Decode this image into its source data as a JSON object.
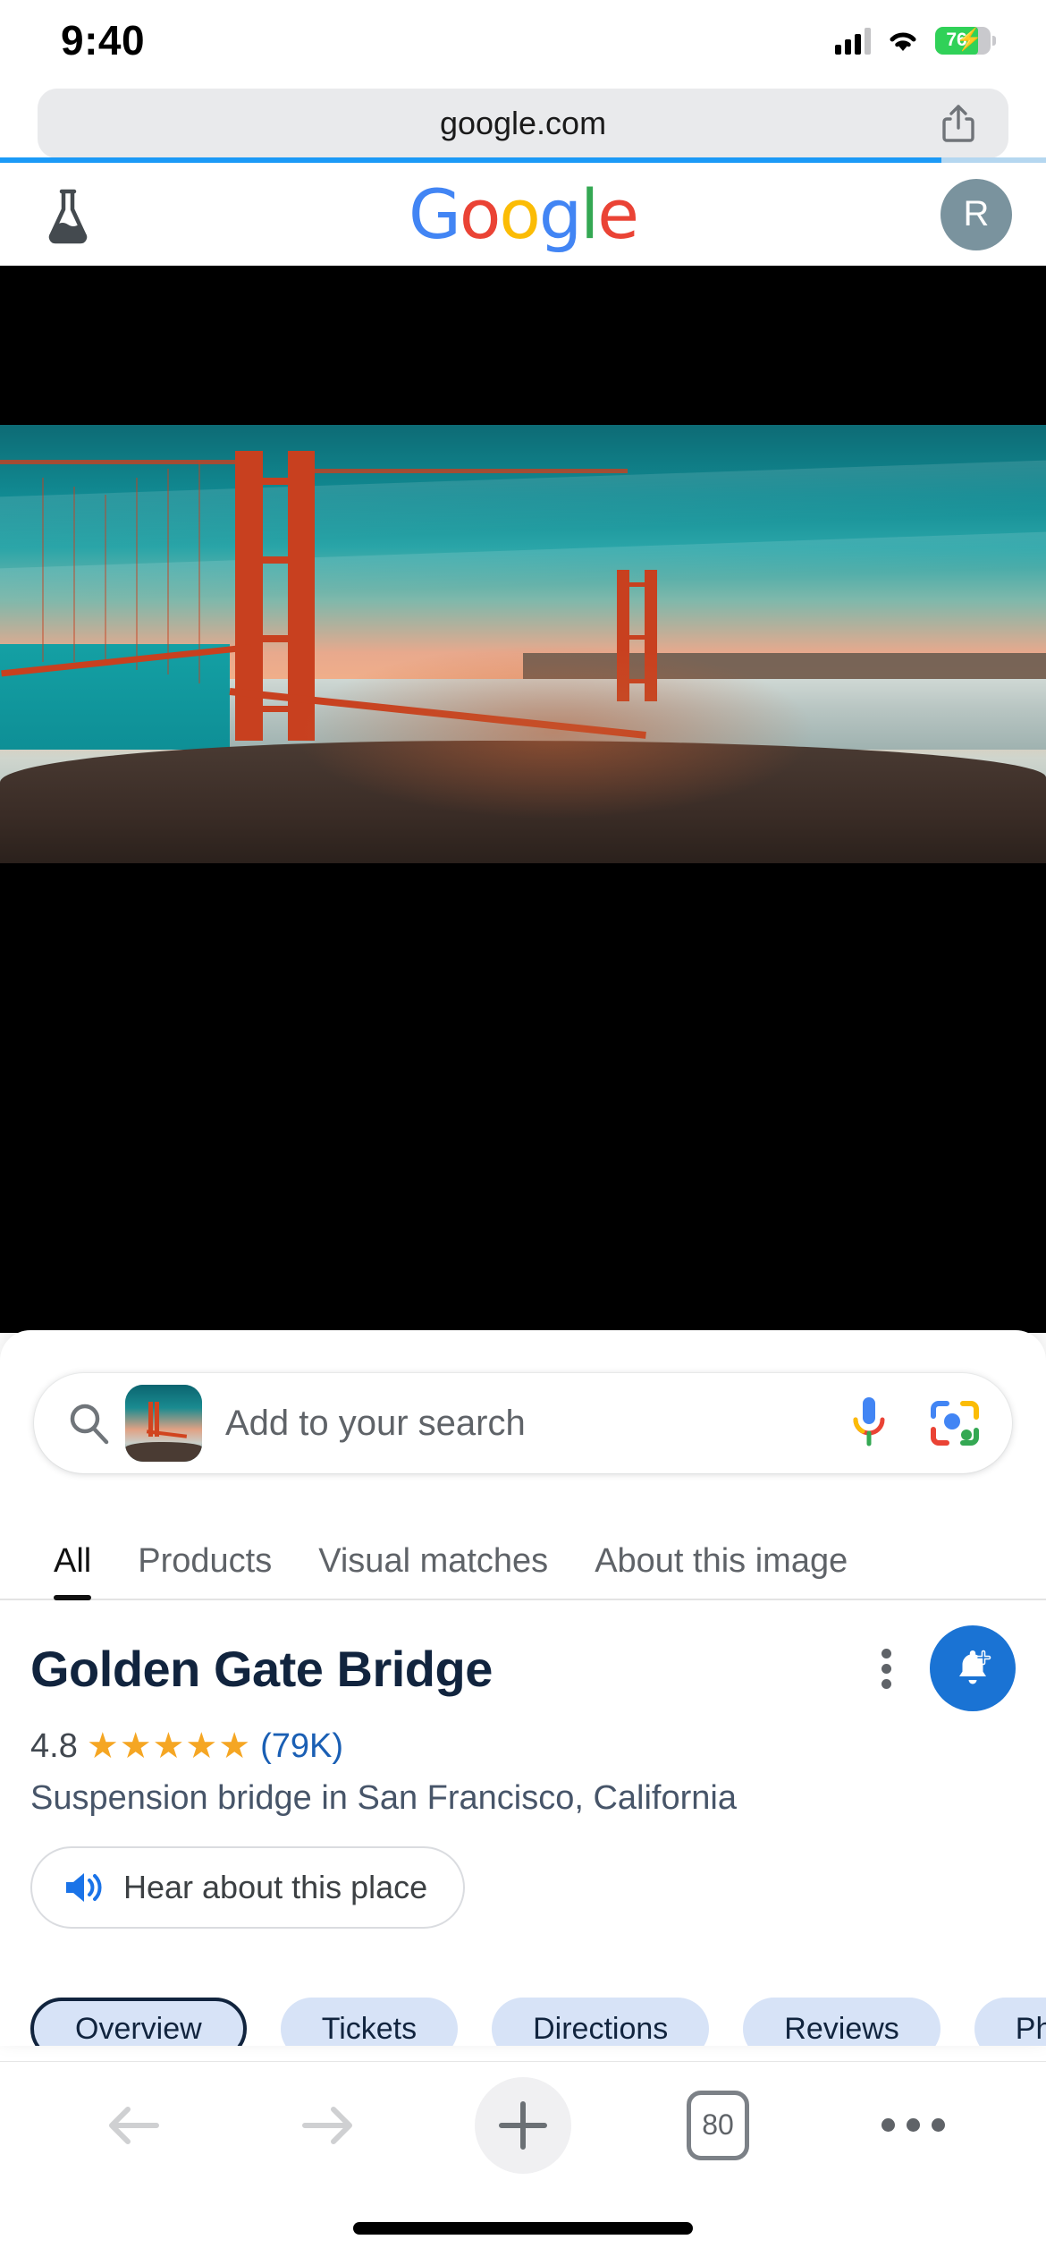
{
  "status_bar": {
    "time": "9:40",
    "battery_percent": "76",
    "battery_charging": true,
    "signal_icon": "cellular-bars-icon",
    "wifi_icon": "wifi-icon",
    "battery_icon": "battery-icon"
  },
  "browser": {
    "url": "google.com",
    "share_icon": "share-icon",
    "progress_percent": 90,
    "toolbar": {
      "back_icon": "back-arrow-icon",
      "forward_icon": "forward-arrow-icon",
      "new_tab_icon": "plus-icon",
      "tab_count": "80",
      "more_icon": "more-dots-icon"
    }
  },
  "google_header": {
    "labs_icon": "lab-flask-icon",
    "logo_letters": [
      "G",
      "o",
      "o",
      "g",
      "l",
      "e"
    ],
    "avatar_initial": "R"
  },
  "search": {
    "placeholder": "Add to your search",
    "search_icon": "search-icon",
    "thumbnail_icon": "image-thumbnail-icon",
    "mic_icon": "microphone-icon",
    "lens_icon": "google-lens-icon"
  },
  "tabs": [
    {
      "label": "All",
      "active": true
    },
    {
      "label": "Products",
      "active": false
    },
    {
      "label": "Visual matches",
      "active": false
    },
    {
      "label": "About this image",
      "active": false
    }
  ],
  "knowledge_panel": {
    "title": "Golden Gate Bridge",
    "rating_value": "4.8",
    "stars": "★★★★★",
    "rating_count": "(79K)",
    "subtitle": "Suspension bridge in San Francisco, California",
    "hear_button_label": "Hear about this place",
    "hear_button_icon": "speaker-icon",
    "menu_icon": "kebab-menu-icon",
    "notify_icon": "add-notification-icon"
  },
  "chips": [
    {
      "label": "Overview",
      "selected": true
    },
    {
      "label": "Tickets",
      "selected": false
    },
    {
      "label": "Directions",
      "selected": false
    },
    {
      "label": "Reviews",
      "selected": false
    },
    {
      "label": "Photos",
      "selected": false
    }
  ],
  "colors": {
    "accent_blue": "#1a73d4",
    "star_gold": "#f5a623",
    "link_blue": "#1a5fb4",
    "title_navy": "#11243e",
    "battery_green": "#30d158",
    "progress_blue": "#1b9af7"
  }
}
